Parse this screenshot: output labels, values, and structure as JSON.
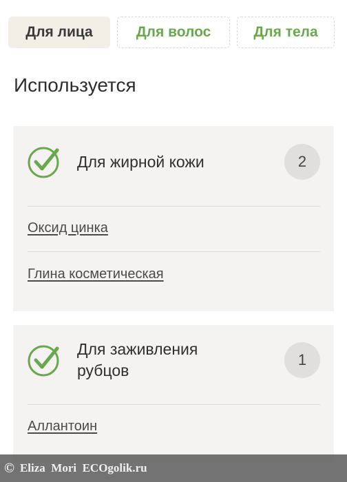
{
  "tabs": [
    {
      "label": "Для лица",
      "active": true
    },
    {
      "label": "Для волос",
      "active": false
    },
    {
      "label": "Для тела",
      "active": false
    }
  ],
  "section_title": "Используется",
  "cards": [
    {
      "title": "Для жирной кожи",
      "count": "2",
      "icon": "checkmark-circle-icon",
      "items": [
        "Оксид цинка",
        "Глина косметическая"
      ]
    },
    {
      "title_line1": "Для заживления",
      "title_line2": "рубцов",
      "count": "1",
      "icon": "checkmark-circle-icon",
      "items": [
        "Аллантоин"
      ]
    }
  ],
  "footer": {
    "symbol": "©",
    "text": "Eliza  Mori  ECOgolik.ru"
  },
  "colors": {
    "accent_green": "#6aa84f",
    "card_bg": "#f4f3f1",
    "active_tab_bg": "#f2f0e6",
    "badge_bg": "#e0dfdd"
  }
}
